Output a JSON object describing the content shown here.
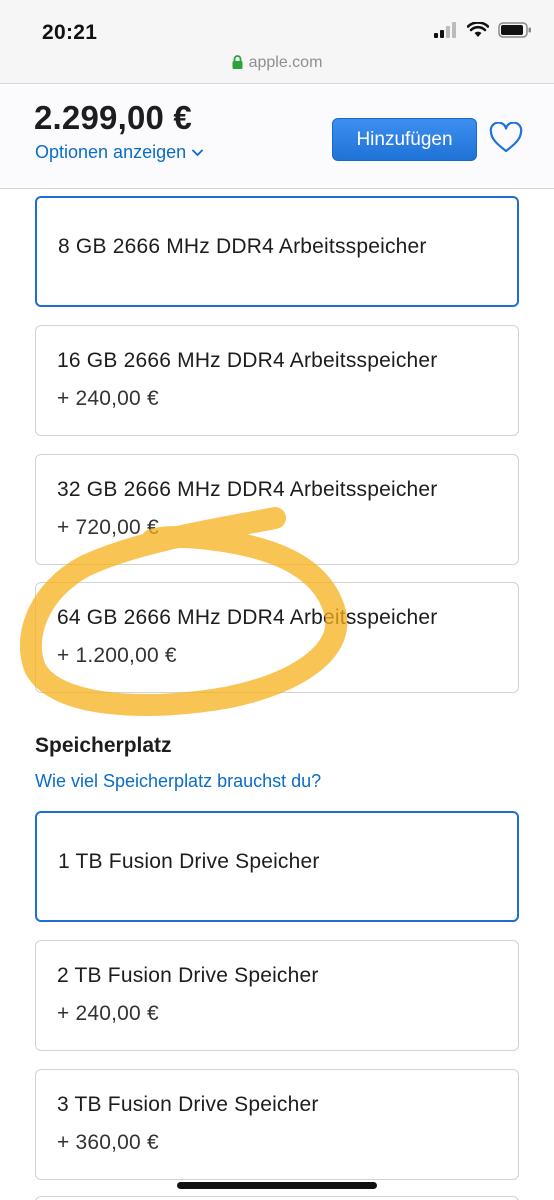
{
  "status_bar": {
    "time": "20:21"
  },
  "address_bar": {
    "domain": "apple.com"
  },
  "header": {
    "price": "2.299,00 €",
    "options_link": "Optionen anzeigen",
    "add_button": "Hinzufügen"
  },
  "memory_options": [
    {
      "title": "8 GB 2666 MHz DDR4 Arbeitsspeicher",
      "price": "",
      "selected": true
    },
    {
      "title": "16 GB 2666 MHz DDR4 Arbeitsspeicher",
      "price": "+ 240,00 €",
      "selected": false
    },
    {
      "title": "32 GB 2666 MHz DDR4 Arbeitsspeicher",
      "price": "+ 720,00 €",
      "selected": false
    },
    {
      "title": "64 GB 2666 MHz DDR4 Arbeitsspeicher",
      "price": "+ 1.200,00 €",
      "selected": false
    }
  ],
  "storage_section": {
    "title": "Speicherplatz",
    "help_link": "Wie viel Speicherplatz brauchst du?"
  },
  "storage_options": [
    {
      "title": "1 TB Fusion Drive Speicher",
      "price": "",
      "selected": true
    },
    {
      "title": "2 TB Fusion Drive Speicher",
      "price": "+ 240,00 €",
      "selected": false
    },
    {
      "title": "3 TB Fusion Drive Speicher",
      "price": "+ 360,00 €",
      "selected": false
    }
  ],
  "colors": {
    "accent_blue": "#0a6cc9",
    "button_blue": "#1f73d6",
    "annotation_highlight": "#f5b21b"
  }
}
